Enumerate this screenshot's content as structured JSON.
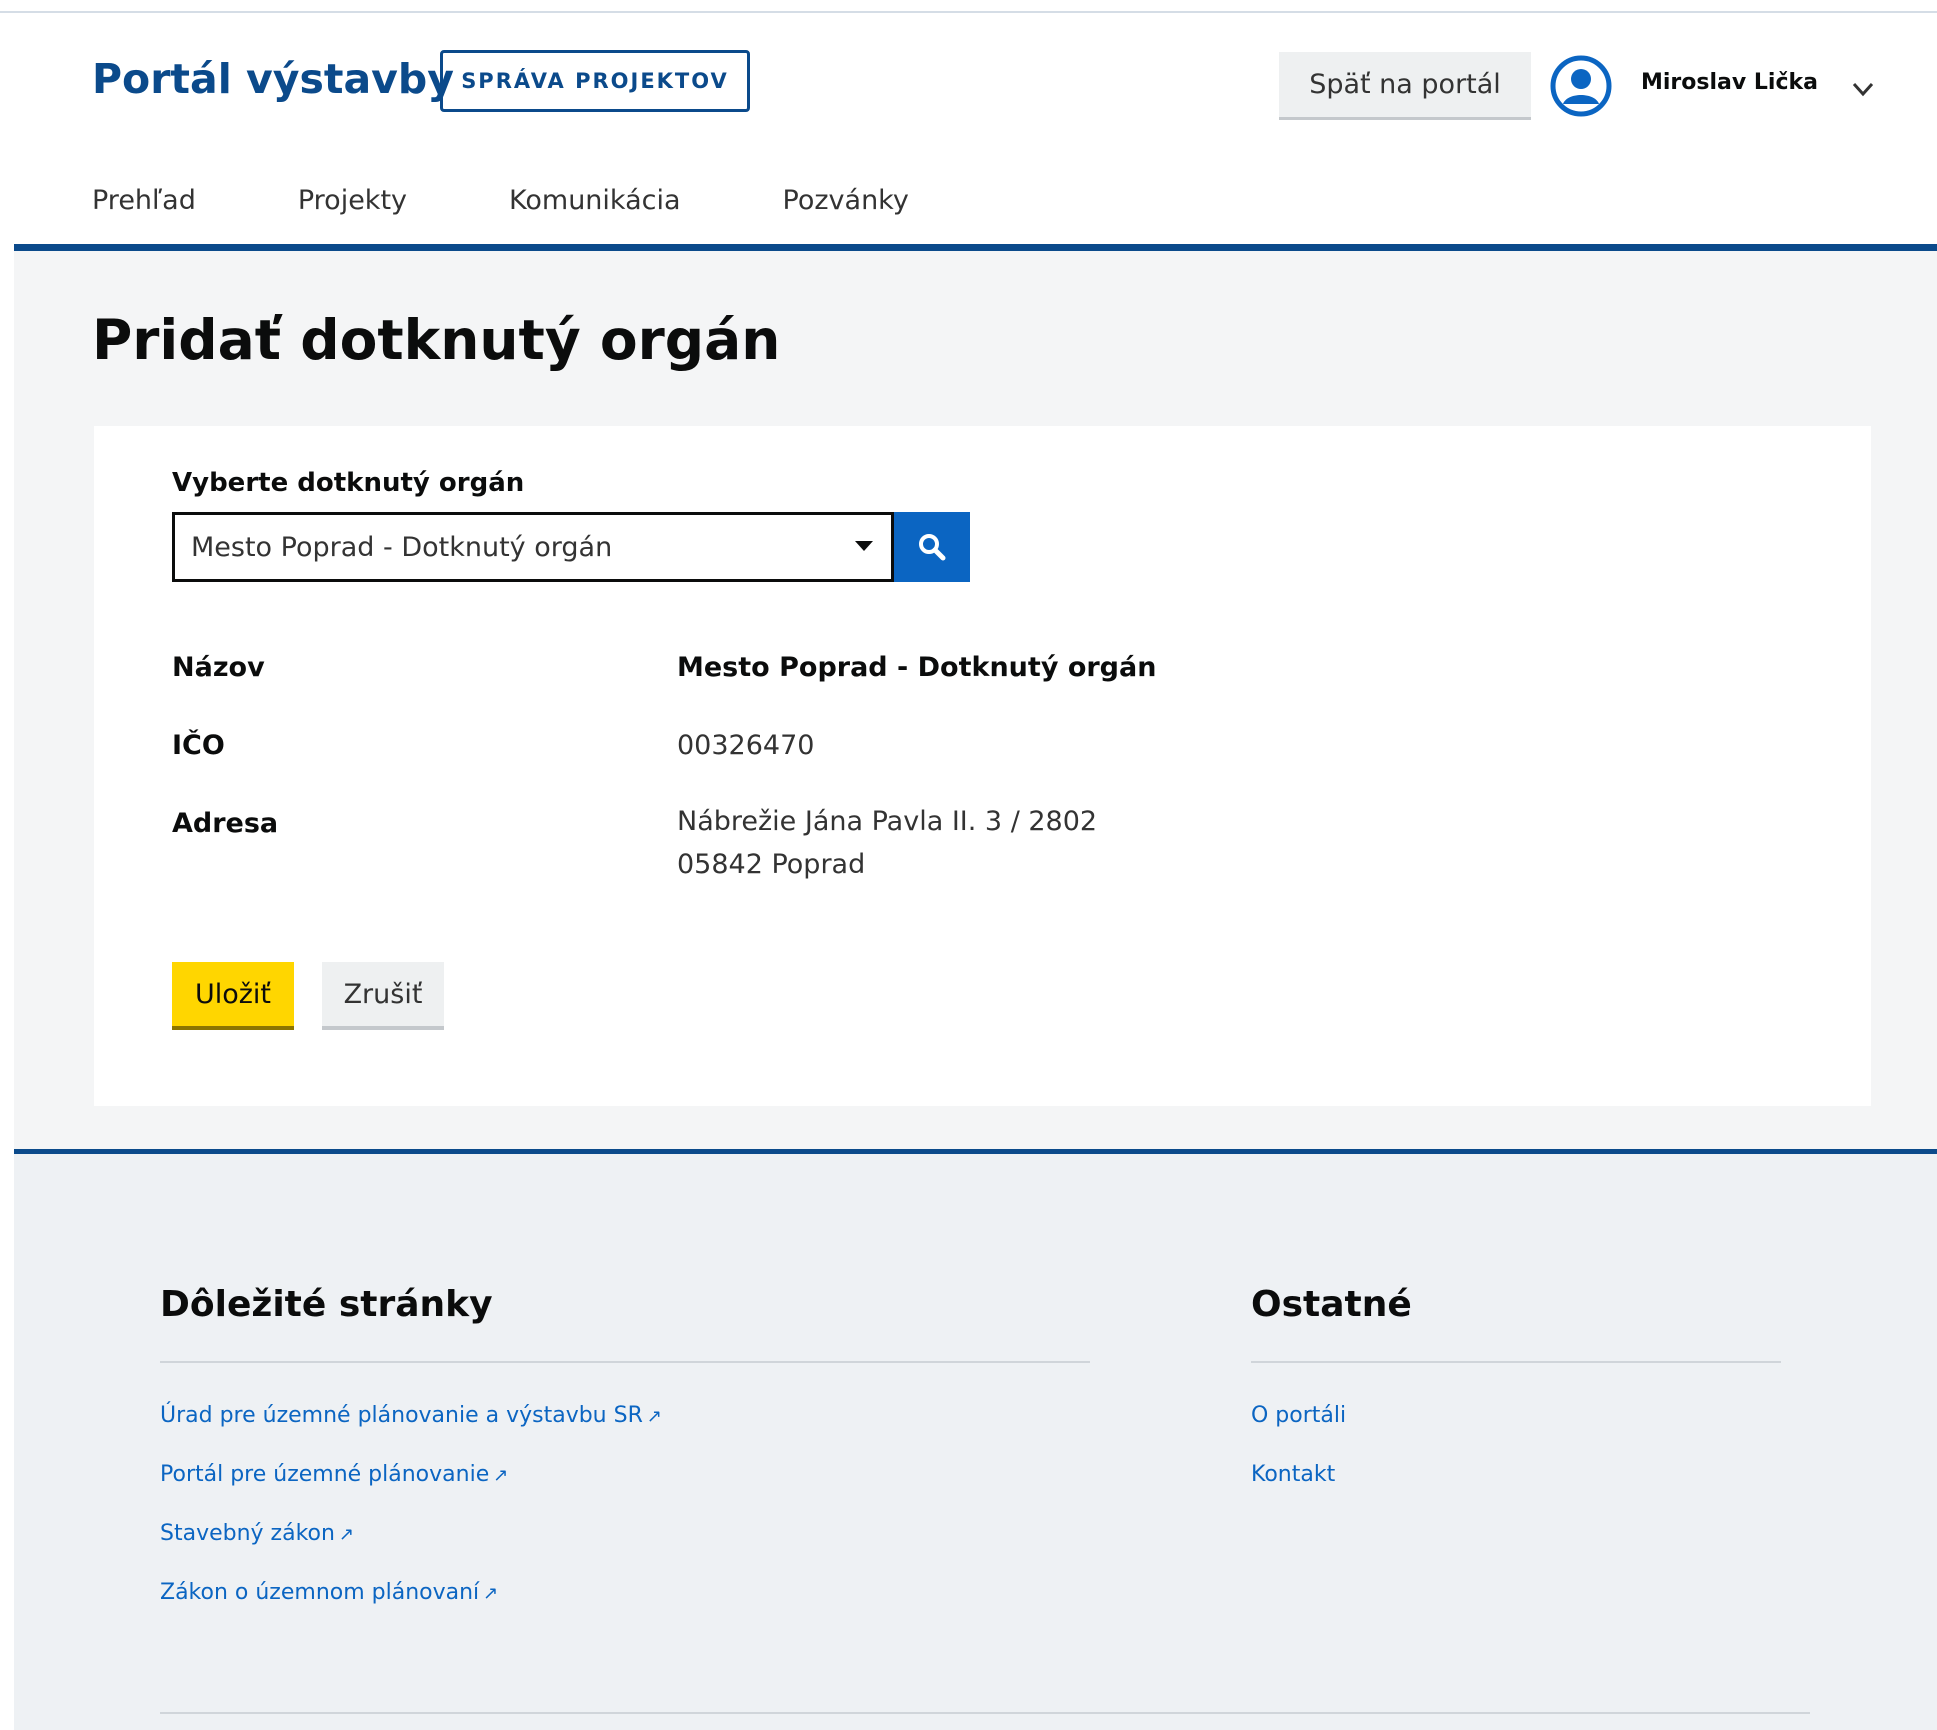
{
  "header": {
    "brand": "Portál výstavby",
    "brand_tag": "SPRÁVA PROJEKTOV",
    "back_label": "Späť na portál",
    "user_name": "Miroslav Lička"
  },
  "nav": {
    "items": [
      "Prehľad",
      "Projekty",
      "Komunikácia",
      "Pozvánky"
    ]
  },
  "main": {
    "title": "Pridať dotknutý orgán",
    "field_label": "Vyberte dotknutý orgán",
    "select_value": "Mesto Poprad - Dotknutý orgán",
    "details": [
      {
        "key": "Názov",
        "value": "Mesto Poprad - Dotknutý orgán"
      },
      {
        "key": "IČO",
        "value": "00326470"
      },
      {
        "key": "Adresa",
        "value_line1": "Nábrežie Jána Pavla II. 3 / 2802",
        "value_line2": "05842 Poprad"
      }
    ],
    "save_label": "Uložiť",
    "cancel_label": "Zrušiť"
  },
  "footer": {
    "important_title": "Dôležité stránky",
    "important_links": [
      "Úrad pre územné plánovanie a výstavbu SR",
      "Portál pre územné plánovanie",
      "Stavebný zákon",
      "Zákon o územnom plánovaní"
    ],
    "other_title": "Ostatné",
    "other_links": [
      "O portáli",
      "Kontakt"
    ]
  },
  "colors": {
    "brand_blue": "#0b4a8b",
    "accent_blue": "#0b65c2",
    "save_yellow": "#ffd600"
  },
  "icons": [
    "user-avatar-icon",
    "chevron-down-icon",
    "dropdown-arrow-icon",
    "search-icon",
    "external-link-icon"
  ]
}
